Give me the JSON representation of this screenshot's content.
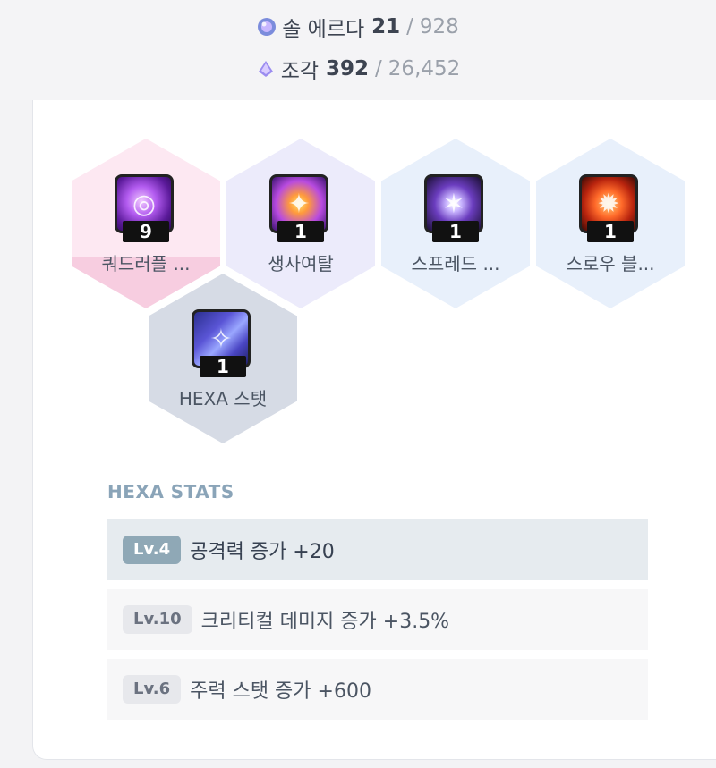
{
  "resources": {
    "sol_erda": {
      "label": "솔 에르다",
      "current": "21",
      "max": "928",
      "icon": "sol-erda-icon"
    },
    "fragment": {
      "label": "조각",
      "current": "392",
      "max": "26,452",
      "icon": "fragment-icon"
    }
  },
  "skills": [
    {
      "name": "쿼드러플 ...",
      "level": "9",
      "icon": "quadruple-skill-icon"
    },
    {
      "name": "생사여탈",
      "level": "1",
      "icon": "life-death-skill-icon"
    },
    {
      "name": "스프레드 ...",
      "level": "1",
      "icon": "spread-skill-icon"
    },
    {
      "name": "스로우 블...",
      "level": "1",
      "icon": "throw-blasting-skill-icon"
    },
    {
      "name": "HEXA 스탯",
      "level": "1",
      "icon": "hexa-stat-icon"
    }
  ],
  "hexa_stats": {
    "title": "HEXA STATS",
    "rows": [
      {
        "level": "Lv.4",
        "text": "공격력 증가 +20"
      },
      {
        "level": "Lv.10",
        "text": "크리티컬 데미지 증가 +3.5%"
      },
      {
        "level": "Lv.6",
        "text": "주력 스탯 증가 +600"
      }
    ]
  },
  "colors": {
    "accent": "#8fa8b6",
    "text": "#374151",
    "muted": "#9aa0aa"
  }
}
